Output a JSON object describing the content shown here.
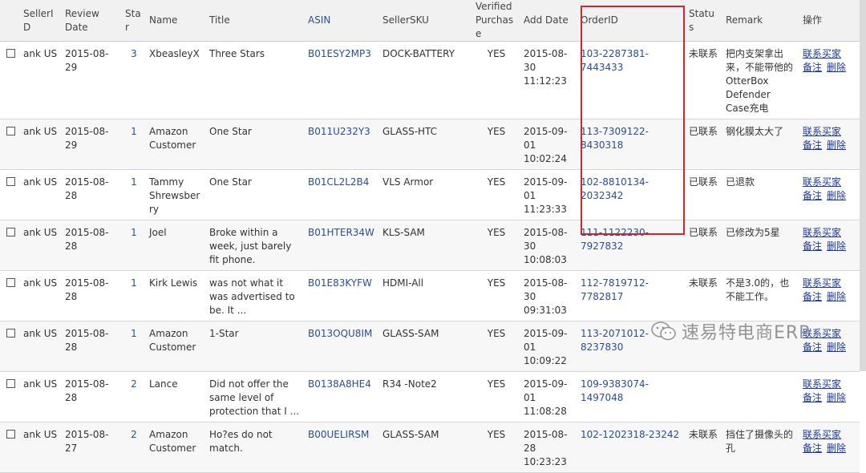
{
  "columns": {
    "seller_id": "SellerID",
    "review_date": "Review Date",
    "star": "Star",
    "name": "Name",
    "title": "Title",
    "asin": "ASIN",
    "seller_sku": "SellerSKU",
    "verified_purchase": "Verified Purchase",
    "add_date": "Add Date",
    "order_id": "OrderID",
    "status": "Status",
    "remark": "Remark",
    "actions": "操作"
  },
  "actions": {
    "contact_buyer": "联系买家",
    "note": "备注",
    "delete": "删除"
  },
  "rows": [
    {
      "seller_id": "ank US",
      "review_date": "2015-08-29",
      "star": "3",
      "name": "XbeasleyX",
      "title": "Three Stars",
      "asin": "B01ESY2MP3",
      "sku": "DOCK-BATTERY",
      "verified": "YES",
      "add_date": "2015-08-30 11:12:23",
      "order_id": "103-2287381-7443433",
      "status": "未联系",
      "remark": "把内支架拿出来，不能带他的OtterBox Defender Case充电"
    },
    {
      "seller_id": "ank US",
      "review_date": "2015-08-29",
      "star": "1",
      "name": "Amazon Customer",
      "title": "One Star",
      "asin": "B011U232Y3",
      "sku": "GLASS-HTC",
      "verified": "YES",
      "add_date": "2015-09-01 10:02:24",
      "order_id": "113-7309122-8430318",
      "status": "已联系",
      "remark": "钢化膜太大了"
    },
    {
      "seller_id": "ank US",
      "review_date": "2015-08-28",
      "star": "1",
      "name": "Tammy Shrewsberry",
      "title": "One Star",
      "asin": "B01CL2L2B4",
      "sku": "VLS Armor",
      "verified": "YES",
      "add_date": "2015-09-01 11:23:33",
      "order_id": "102-8810134-2032342",
      "status": "已联系",
      "remark": "已退款"
    },
    {
      "seller_id": "ank US",
      "review_date": "2015-08-28",
      "star": "1",
      "name": "Joel",
      "title": "Broke within a week, just barely fit phone.",
      "asin": "B01HTER34W",
      "sku": "KLS-SAM",
      "verified": "YES",
      "add_date": "2015-08-30 10:08:03",
      "order_id": "111-1122230-7927832",
      "status": "已联系",
      "remark": "已修改为5星"
    },
    {
      "seller_id": "ank US",
      "review_date": "2015-08-28",
      "star": "1",
      "name": "Kirk Lewis",
      "title": "was not what it was advertised to be. It ...",
      "asin": "B01E83KYFW",
      "sku": "HDMI-All",
      "verified": "YES",
      "add_date": "2015-08-30 09:31:03",
      "order_id": "112-7819712-7782817",
      "status": "未联系",
      "remark": "不是3.0的，也不能工作。"
    },
    {
      "seller_id": "ank US",
      "review_date": "2015-08-28",
      "star": "1",
      "name": "Amazon Customer",
      "title": "1-Star",
      "asin": "B013OQU8IM",
      "sku": "GLASS-SAM",
      "verified": "YES",
      "add_date": "2015-09-01 10:09:22",
      "order_id": "113-2071012-8237830",
      "status": "",
      "remark": ""
    },
    {
      "seller_id": "ank US",
      "review_date": "2015-08-28",
      "star": "2",
      "name": "Lance",
      "title": "Did not offer the same level of protection that I ...",
      "asin": "B0138A8HE4",
      "sku": "R34 -Note2",
      "verified": "YES",
      "add_date": "2015-09-01 11:08:28",
      "order_id": "109-9383074-1497048",
      "status": "",
      "remark": ""
    },
    {
      "seller_id": "ank US",
      "review_date": "2015-08-27",
      "star": "2",
      "name": "Amazon Customer",
      "title": "Ho?es do not match.",
      "asin": "B00UELIRSM",
      "sku": "GLASS-SAM",
      "verified": "YES",
      "add_date": "2015-08-28 10:23:23",
      "order_id": "102-1202318-23242",
      "status": "未联系",
      "remark": "挡住了摄像头的孔"
    }
  ],
  "watermark": {
    "text": "速易特电商ERP",
    "icon": "wechat-icon"
  },
  "colors": {
    "highlight_box": "#d9222a",
    "link": "#1a3aa0",
    "asin": "#2a4d9b"
  }
}
